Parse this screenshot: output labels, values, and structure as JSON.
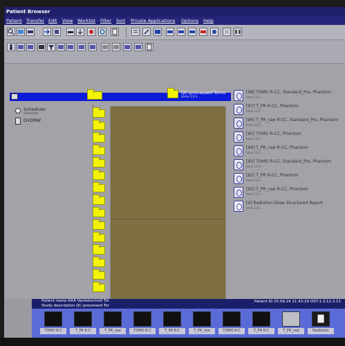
{
  "window": {
    "title": "Patient Browser"
  },
  "menu": [
    "Patient",
    "Transfer",
    "Edit",
    "View",
    "Worklist",
    "Filter",
    "Sort",
    "Private Applications",
    "Options",
    "Help"
  ],
  "tree": {
    "computer_sub": "",
    "scheduler": {
      "label": "Scheduler",
      "sub": "scheduler"
    },
    "dvdrw": {
      "label": "DVDRW",
      "sub": ""
    },
    "selected_title": "QC-processed Tomo",
    "selected_sub": "tomo 11/3 ..."
  },
  "series": [
    {
      "label": "[98] TOMO R-CC, Standard_Pro, Phantom",
      "sub": "tomo 11/3 ..."
    },
    {
      "label": "[97] T_PR R-CC, Phantom",
      "sub": "tomo 11/3 ..."
    },
    {
      "label": "[96] T_PR_raw R-CC, Standard_Pro, Phantom",
      "sub": "tomo 11/3 ..."
    },
    {
      "label": "[95] TOMO R-CC, Phantom",
      "sub": "tomo 11/3 ..."
    },
    {
      "label": "[94] T_PR_raw R-CC, Phantom",
      "sub": "tomo 11/3 ..."
    },
    {
      "label": "[93] TOMO R-CC, Standard_Pro, Phantom",
      "sub": "tomo 11/3 ..."
    },
    {
      "label": "[92] T_PR R-CC, Phantom",
      "sub": "tomo 11/3 ..."
    },
    {
      "label": "[91] T_PR_raw R-CC, Phantom",
      "sub": "tomo 11/3 ..."
    },
    {
      "label": "[4] Radiation Dose Structured Report",
      "sub": "tomo 11/3 ..."
    }
  ],
  "status": {
    "patient_name": "Patient name AAA Vackokontroll Tor",
    "study_description": "Study description QC-processed Tor",
    "patient_id": "Patient ID 25.09.24 11:43:29 OST-1.3.12.2.11"
  },
  "thumbnails": [
    "TOMO R-C",
    "T_PR R-C",
    "T_PR_raw",
    "TOMO R-C",
    "T_PR R-C",
    "T_PR_raw",
    "TOMO R-C",
    "T_PR R-C",
    "T_PR_raw",
    "Radiation"
  ]
}
